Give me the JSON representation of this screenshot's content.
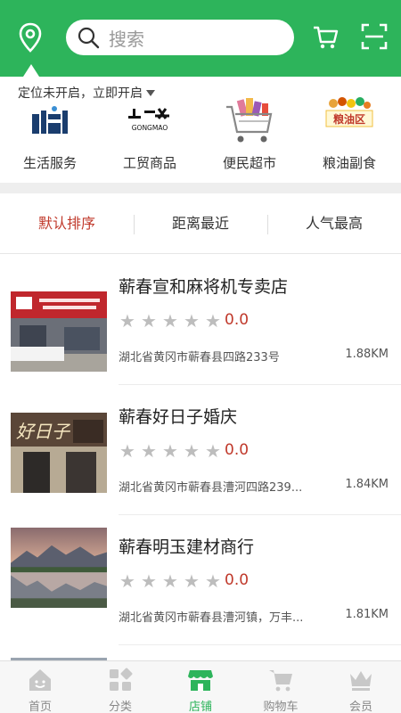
{
  "header": {
    "search_placeholder": "搜索",
    "brand_color": "#2db45b"
  },
  "location_notice": "定位未开启，立即开启",
  "categories": [
    {
      "label": "生活服务",
      "icon": "life-service-logo"
    },
    {
      "label": "工贸商品",
      "icon": "gongmao-logo"
    },
    {
      "label": "便民超市",
      "icon": "shopping-cart-photo"
    },
    {
      "label": "粮油副食",
      "icon": "grain-oil-logo"
    }
  ],
  "category_logo_texts": {
    "gongmao": "GONGMAO",
    "grain": "粮油区"
  },
  "sort_tabs": [
    {
      "label": "默认排序",
      "active": true
    },
    {
      "label": "距离最近",
      "active": false
    },
    {
      "label": "人气最高",
      "active": false
    }
  ],
  "stores": [
    {
      "name": "蕲春宣和麻将机专卖店",
      "rating": "0.0",
      "address": "湖北省黄冈市蕲春县四路233号",
      "distance": "1.88KM"
    },
    {
      "name": "蕲春好日子婚庆",
      "rating": "0.0",
      "address": "湖北省黄冈市蕲春县漕河四路239...",
      "distance": "1.84KM"
    },
    {
      "name": "蕲春明玉建材商行",
      "rating": "0.0",
      "address": "湖北省黄冈市蕲春县漕河镇，万丰...",
      "distance": "1.81KM"
    }
  ],
  "bottom_nav": [
    {
      "label": "首页",
      "icon": "home-icon",
      "active": false
    },
    {
      "label": "分类",
      "icon": "category-icon",
      "active": false
    },
    {
      "label": "店铺",
      "icon": "store-icon",
      "active": true
    },
    {
      "label": "购物车",
      "icon": "cart-icon",
      "active": false
    },
    {
      "label": "会员",
      "icon": "crown-icon",
      "active": false
    }
  ]
}
